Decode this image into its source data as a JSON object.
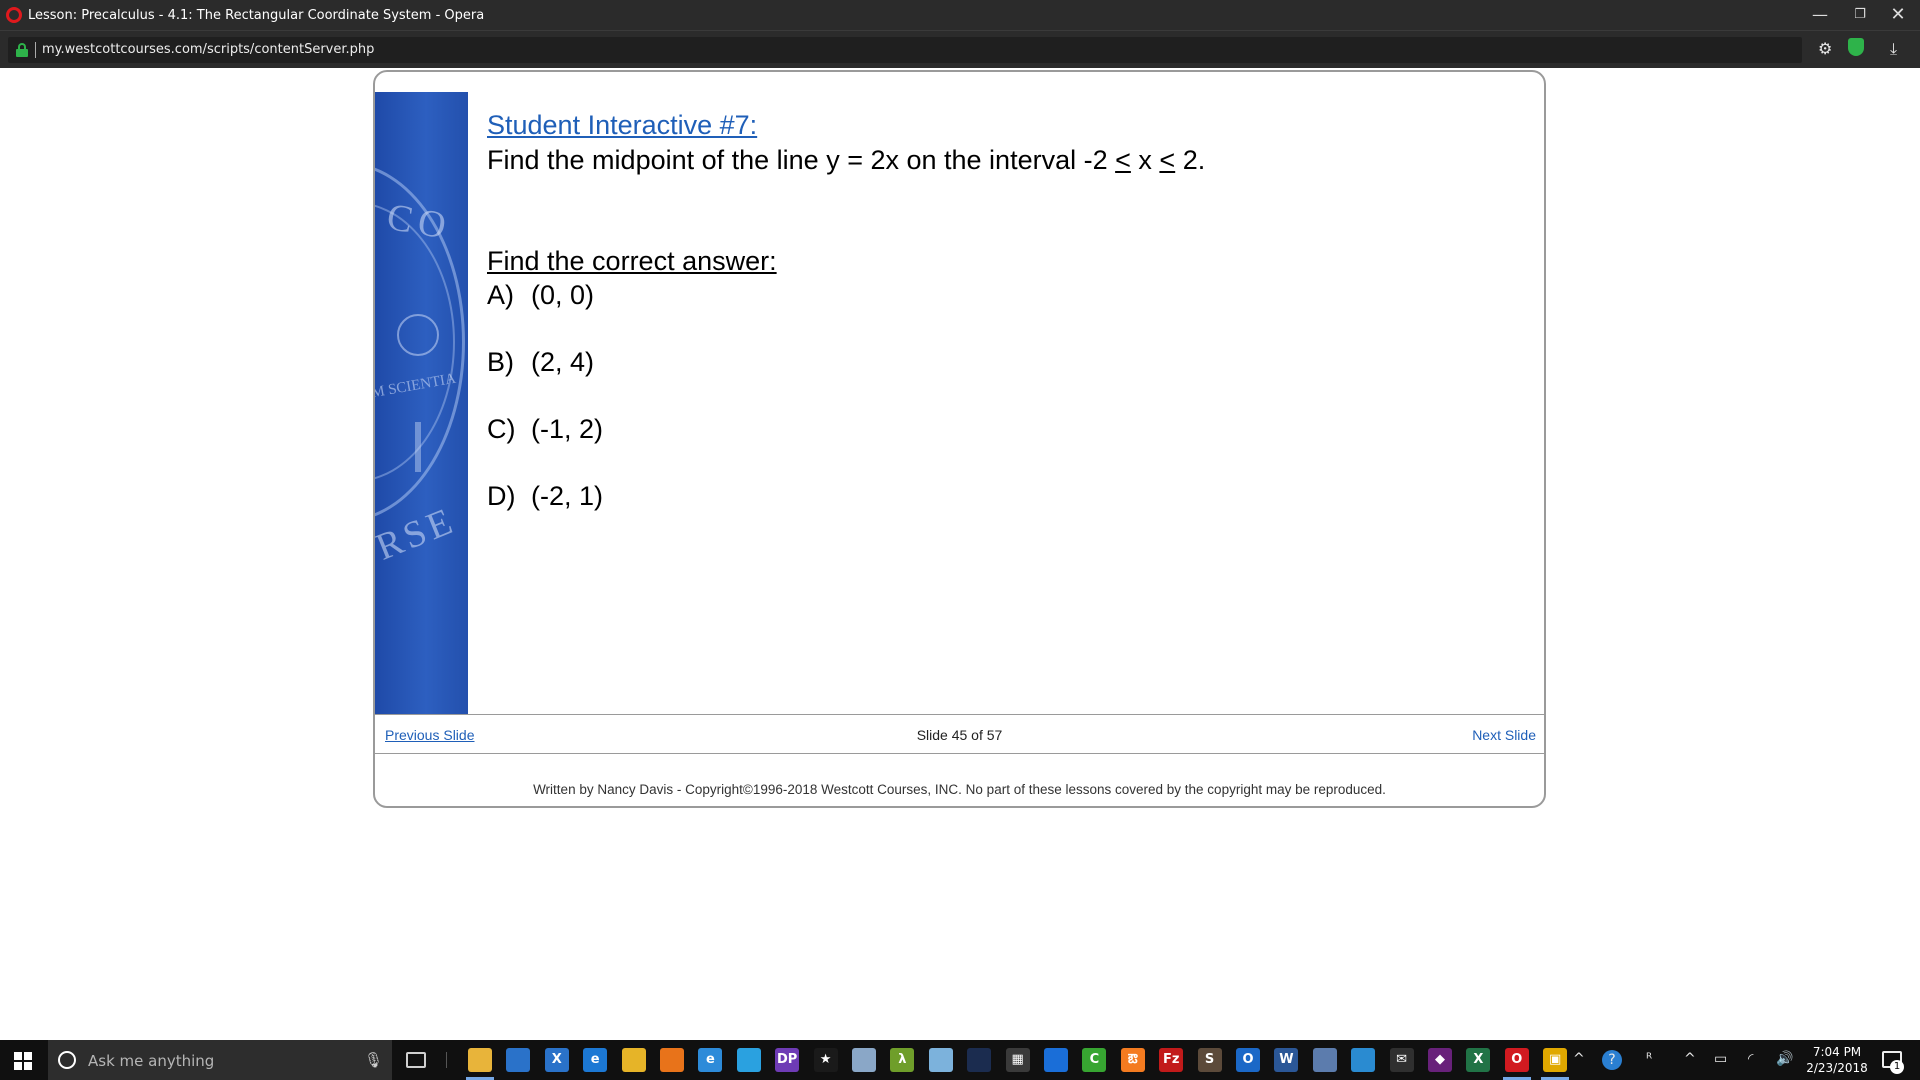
{
  "window": {
    "title": "Lesson: Precalculus - 4.1: The Rectangular Coordinate System - Opera",
    "minimize_glyph": "—",
    "restore_glyph": "❐",
    "close_glyph": "✕"
  },
  "addressbar": {
    "url": "my.westcottcourses.com/scripts/contentServer.php",
    "settings_glyph": "⚙",
    "download_glyph": "⤓"
  },
  "slide": {
    "heading": "Student Interactive #7:",
    "question_parts": {
      "prefix": "Find the midpoint of the line y = 2x on the interval -2 ",
      "le1": "<",
      "mid": " x ",
      "le2": "<",
      "suffix": " 2."
    },
    "answer_heading": "Find the correct answer:",
    "options": [
      {
        "letter": "A)",
        "value": "(0, 0)"
      },
      {
        "letter": "B)",
        "value": "(2, 4)"
      },
      {
        "letter": "C)",
        "value": "(-1, 2)"
      },
      {
        "letter": "D)",
        "value": "(-2, 1)"
      }
    ],
    "seal_text": {
      "top": "CO",
      "middle": "M SCIENTIA",
      "bottom": "RSE"
    }
  },
  "navigation": {
    "previous": "Previous Slide",
    "slide_count": "Slide 45 of 57",
    "next": "Next Slide"
  },
  "footer": {
    "copyright": "Written by Nancy Davis - Copyright©1996-2018 Westcott Courses, INC. No part of these lessons covered by the copyright may be reproduced."
  },
  "taskbar": {
    "search_placeholder": "Ask me anything",
    "mic_glyph": "🎙",
    "apps": [
      {
        "name": "file-explorer",
        "label": "",
        "color": "#e8b43a"
      },
      {
        "name": "store",
        "label": "",
        "color": "#2a72c9"
      },
      {
        "name": "xmind",
        "label": "X",
        "color": "#2a72c9"
      },
      {
        "name": "edge",
        "label": "e",
        "color": "#1c78d4"
      },
      {
        "name": "chrome",
        "label": "",
        "color": "#e6b428"
      },
      {
        "name": "firefox",
        "label": "",
        "color": "#e8731a"
      },
      {
        "name": "internet-explorer",
        "label": "e",
        "color": "#2d8bd9"
      },
      {
        "name": "powershell",
        "label": "",
        "color": "#2aa1e0"
      },
      {
        "name": "dp-app",
        "label": "DP",
        "color": "#6e3bb5"
      },
      {
        "name": "star-app",
        "label": "★",
        "color": "#1a1a1a"
      },
      {
        "name": "synaptic-app",
        "label": "",
        "color": "#8aa7c7"
      },
      {
        "name": "lambda-app",
        "label": "λ",
        "color": "#6f9e2a"
      },
      {
        "name": "sketch-app",
        "label": "",
        "color": "#7cb2dc"
      },
      {
        "name": "indie-app",
        "label": "",
        "color": "#1b2c4f"
      },
      {
        "name": "calculator",
        "label": "▦",
        "color": "#3a3a3a"
      },
      {
        "name": "teamviewer",
        "label": "",
        "color": "#1a6ed8"
      },
      {
        "name": "camtasia",
        "label": "C",
        "color": "#37a531"
      },
      {
        "name": "xampp",
        "label": "ఔ",
        "color": "#f47b20"
      },
      {
        "name": "filezilla",
        "label": "Fz",
        "color": "#c21a1a"
      },
      {
        "name": "sublime",
        "label": "S",
        "color": "#5c4a3a"
      },
      {
        "name": "outlook",
        "label": "O",
        "color": "#1b68c7"
      },
      {
        "name": "word",
        "label": "W",
        "color": "#2b5797"
      },
      {
        "name": "people-app",
        "label": "",
        "color": "#5c7cad"
      },
      {
        "name": "remote-desktop",
        "label": "",
        "color": "#2a8bd1"
      },
      {
        "name": "mail",
        "label": "✉",
        "color": "#2f2f2f"
      },
      {
        "name": "visual-studio",
        "label": "◆",
        "color": "#68217a"
      },
      {
        "name": "excel",
        "label": "X",
        "color": "#217346"
      },
      {
        "name": "opera",
        "label": "O",
        "color": "#d11a20"
      },
      {
        "name": "slides-app",
        "label": "▣",
        "color": "#e0a800"
      }
    ],
    "tray": {
      "chevron_glyph": "^",
      "help_glyph": "?",
      "people_glyph": "ᴿ",
      "battery_glyph": "▭",
      "wifi_glyph": "◜",
      "volume_glyph": "🔊"
    },
    "time": "7:04 PM",
    "date": "2/23/2018",
    "notification_count": "1"
  }
}
